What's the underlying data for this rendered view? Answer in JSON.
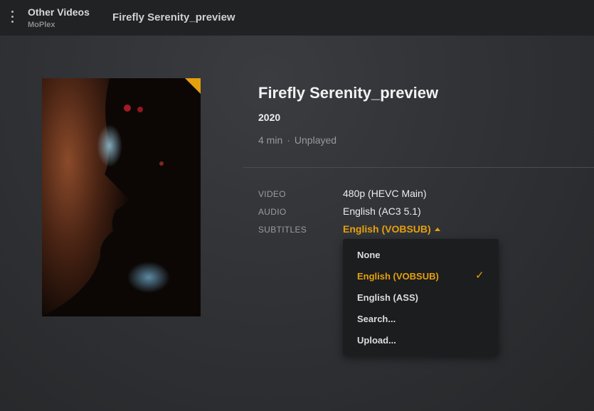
{
  "topbar": {
    "library_title": "Other Videos",
    "library_subtitle": "MoPlex",
    "breadcrumb": "Firefly Serenity_preview"
  },
  "item": {
    "title": "Firefly Serenity_preview",
    "year": "2020",
    "duration": "4 min",
    "separator": "·",
    "status": "Unplayed"
  },
  "specs": {
    "video_label": "VIDEO",
    "video_value": "480p (HEVC Main)",
    "audio_label": "AUDIO",
    "audio_value": "English (AC3 5.1)",
    "subtitles_label": "SUBTITLES",
    "subtitles_value": "English (VOBSUB)"
  },
  "subtitle_menu": {
    "items": [
      "None",
      "English (VOBSUB)",
      "English (ASS)",
      "Search...",
      "Upload..."
    ],
    "selected": "English (VOBSUB)",
    "check_glyph": "✓"
  },
  "colors": {
    "accent": "#e5a00d",
    "topbar": "#202224",
    "background": "#2d2f32",
    "menu": "#1c1d1f"
  },
  "icons": [
    "kebab-menu-icon",
    "caret-up-icon",
    "checkmark-icon",
    "unwatched-corner-badge"
  ]
}
